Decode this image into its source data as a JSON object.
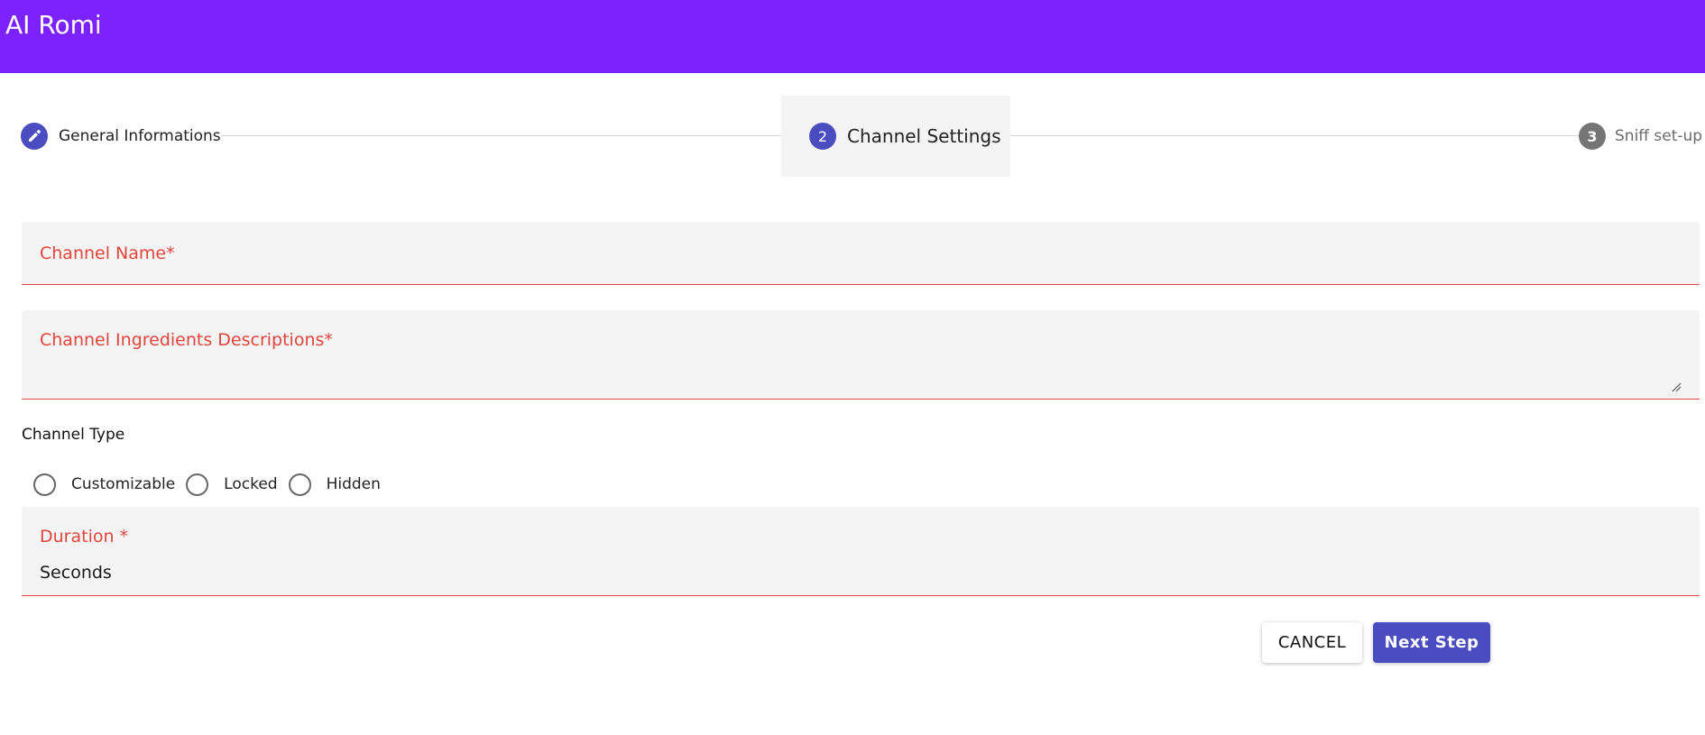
{
  "app": {
    "title": "AI Romi",
    "bar_color": "#7b22ff"
  },
  "stepper": {
    "steps": [
      {
        "label": "General Informations",
        "icon": "pencil-icon",
        "state": "completed"
      },
      {
        "label": "Channel Settings",
        "number": "2",
        "state": "active"
      },
      {
        "label": "Sniff set-up",
        "number": "3",
        "state": "pending"
      }
    ]
  },
  "form": {
    "channel_name": {
      "label": "Channel Name*",
      "value": ""
    },
    "ingredients": {
      "label": "Channel Ingredients Descriptions*",
      "value": ""
    },
    "channel_type": {
      "label": "Channel Type",
      "options": [
        "Customizable",
        "Locked",
        "Hidden"
      ],
      "selected": null
    },
    "duration": {
      "label": "Duration *",
      "value": "Seconds"
    }
  },
  "actions": {
    "cancel_label": "CANCEL",
    "next_label": "Next Step"
  },
  "colors": {
    "accent": "#4a4cc0",
    "error": "#e0443c",
    "field_bg": "#f4f4f4"
  }
}
